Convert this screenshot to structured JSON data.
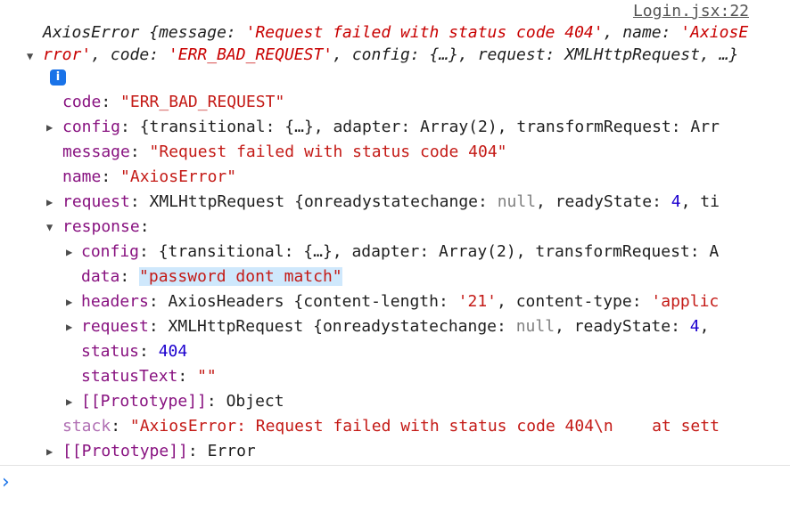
{
  "source_link": "Login.jsx:22",
  "summary": {
    "class_name": "AxiosError",
    "open": " {",
    "message_key": "message: ",
    "message_val": "'Request failed with status code 404'",
    "sep1": ", ",
    "name_key": "name: ",
    "name_val": "'AxiosError'",
    "sep2": ", ",
    "code_key": "code: ",
    "code_val": "'ERR_BAD_REQUEST'",
    "rest": ", config: {…}, request: XMLHttpRequest, …}",
    "info_icon": "i"
  },
  "props": {
    "code": {
      "key": "code",
      "value": "\"ERR_BAD_REQUEST\""
    },
    "config": {
      "key": "config",
      "value": "{transitional: {…}, adapter: Array(2), transformRequest: Arr"
    },
    "message": {
      "key": "message",
      "value": "\"Request failed with status code 404\""
    },
    "name": {
      "key": "name",
      "value": "\"AxiosError\""
    },
    "request": {
      "key": "request",
      "pre": "XMLHttpRequest {onreadystatechange: ",
      "null": "null",
      "mid": ", readyState: ",
      "num": "4",
      "post": ", ti"
    },
    "response": {
      "key": "response",
      "config": {
        "key": "config",
        "value": "{transitional: {…}, adapter: Array(2), transformRequest: A"
      },
      "data": {
        "key": "data",
        "value": "\"password dont match\""
      },
      "headers": {
        "key": "headers",
        "pre": "AxiosHeaders {content-length: ",
        "v1": "'21'",
        "mid": ", content-type: ",
        "v2": "'applic"
      },
      "request": {
        "key": "request",
        "pre": "XMLHttpRequest {onreadystatechange: ",
        "null": "null",
        "mid": ", readyState: ",
        "num": "4",
        "post": ","
      },
      "status": {
        "key": "status",
        "value": "404"
      },
      "statusText": {
        "key": "statusText",
        "value": "\"\""
      },
      "prototype": {
        "key": "[[Prototype]]",
        "value": "Object"
      }
    },
    "stack": {
      "key": "stack",
      "value": "\"AxiosError: Request failed with status code 404\\n    at sett"
    },
    "prototype": {
      "key": "[[Prototype]]",
      "value": "Error"
    }
  },
  "colon": ": ",
  "arrows": {
    "expanded": "▼",
    "collapsed": "▶"
  },
  "prompt": "›"
}
